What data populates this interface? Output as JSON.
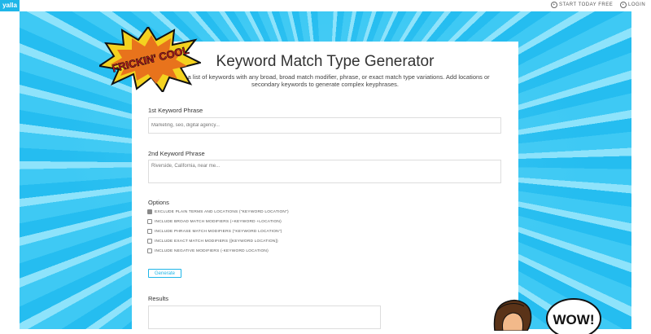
{
  "topbar": {
    "logo": "yalla",
    "start_label": "START TODAY FREE",
    "login_label": "LOGIN"
  },
  "badge": {
    "text": "FRICKIN' COOL"
  },
  "card": {
    "title": "Keyword Match Type Generator",
    "subtitle": "Generate a list of keywords with any broad, broad match modifier, phrase, or exact match type variations. Add locations or secondary keywords to generate complex keyphrases.",
    "kw1_label": "1st Keyword Phrase",
    "kw1_placeholder": "Marketing, seo, digital agency...",
    "kw2_label": "2nd Keyword Phrase",
    "kw2_placeholder": "Riverside, California, near me...",
    "options_label": "Options",
    "options": [
      {
        "label": "EXCLUDE PLAIN TERMS AND LOCATIONS (\"KEYWORD LOCATION\")",
        "checked": true
      },
      {
        "label": "INCLUDE BROAD MATCH MODIFIERS (+KEYWORD +LOCATION)",
        "checked": false
      },
      {
        "label": "INCLUDE PHRASE MATCH MODIFIERS (\"KEYWORD LOCATION\")",
        "checked": false
      },
      {
        "label": "INCLUDE EXACT MATCH MODIFIERS ([KEYWORD LOCATION])",
        "checked": false
      },
      {
        "label": "INCLUDE NEGATIVE MODIFIERS (-KEYWORD LOCATION)",
        "checked": false
      }
    ],
    "generate_label": "Generate",
    "results_label": "Results"
  },
  "art": {
    "wow_text": "WOW!"
  },
  "colors": {
    "accent": "#1fb6e8",
    "burst_blue": "#3ec9f4"
  }
}
